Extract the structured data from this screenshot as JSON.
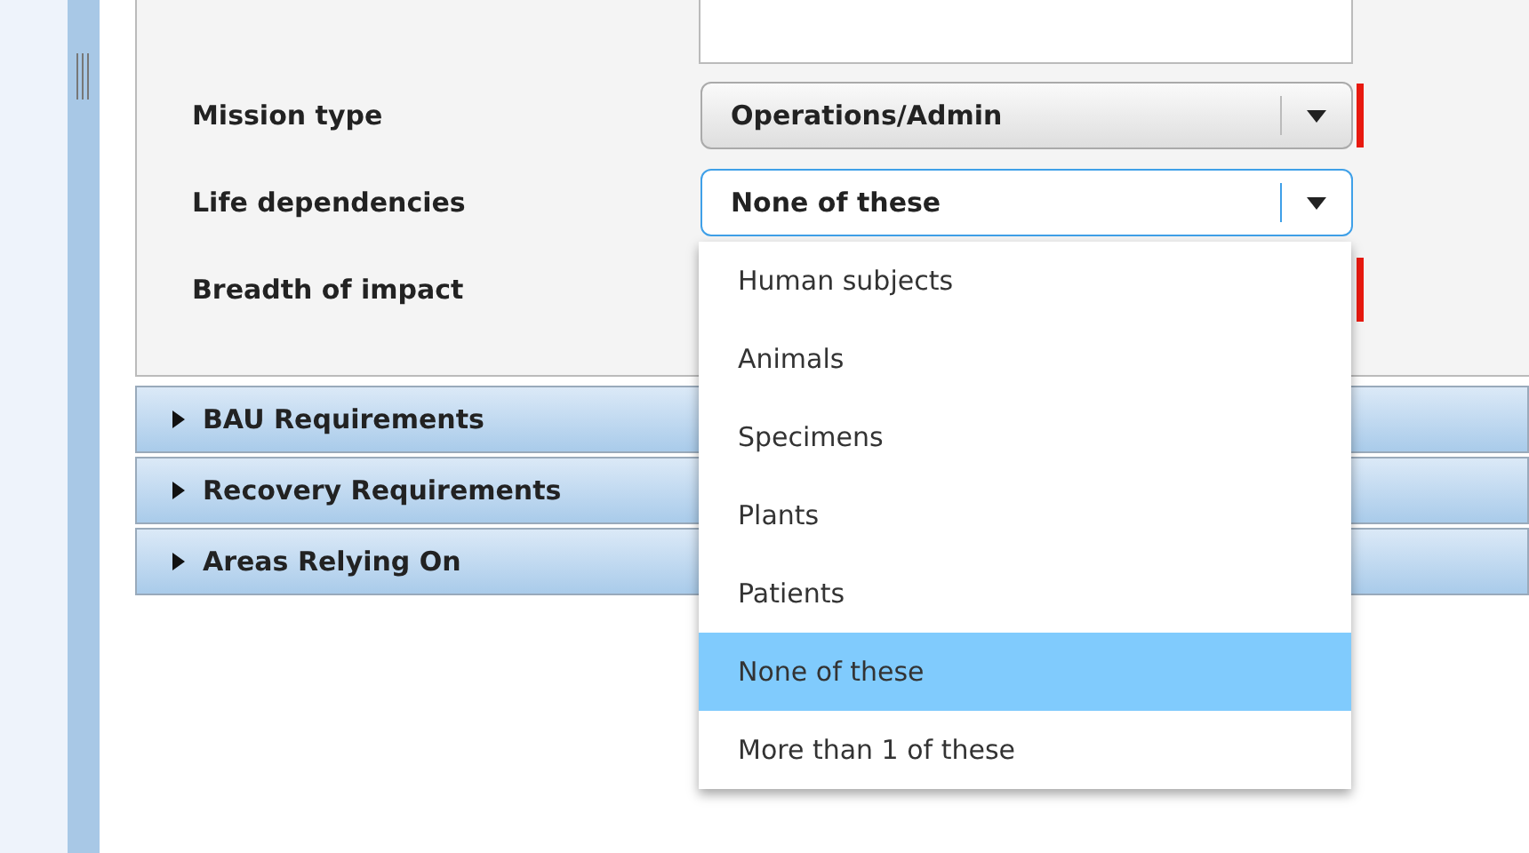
{
  "form": {
    "fields": [
      {
        "label": "Mission type",
        "value": "Operations/Admin",
        "required": true,
        "focused": false
      },
      {
        "label": "Life dependencies",
        "value": "None of these",
        "required": false,
        "focused": true
      },
      {
        "label": "Breadth of impact",
        "required": true
      }
    ]
  },
  "sections": [
    {
      "title": "BAU Requirements"
    },
    {
      "title": "Recovery Requirements"
    },
    {
      "title": "Areas Relying On"
    }
  ],
  "dropdown": {
    "options": [
      {
        "label": "Human subjects",
        "selected": false
      },
      {
        "label": "Animals",
        "selected": false
      },
      {
        "label": "Specimens",
        "selected": false
      },
      {
        "label": "Plants",
        "selected": false
      },
      {
        "label": "Patients",
        "selected": false
      },
      {
        "label": "None of these",
        "selected": true
      },
      {
        "label": "More than 1 of these",
        "selected": false
      }
    ]
  }
}
